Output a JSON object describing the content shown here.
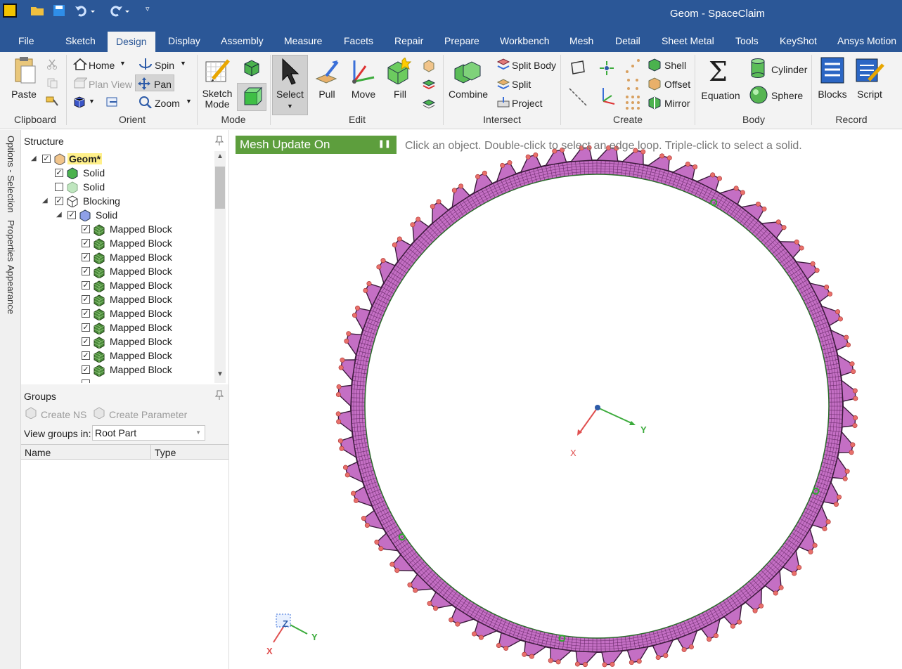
{
  "window": {
    "title": "Geom - SpaceClaim"
  },
  "tabs": [
    "File",
    "Sketch",
    "Design",
    "Display",
    "Assembly",
    "Measure",
    "Facets",
    "Repair",
    "Prepare",
    "Workbench",
    "Mesh",
    "Detail",
    "Sheet Metal",
    "Tools",
    "KeyShot",
    "Ansys Motion"
  ],
  "ribbon": {
    "clipboard": {
      "label": "Clipboard",
      "paste": "Paste"
    },
    "orient": {
      "label": "Orient",
      "home": "Home",
      "spin": "Spin",
      "plan_view": "Plan View",
      "pan": "Pan",
      "zoom": "Zoom"
    },
    "mode": {
      "label": "Mode",
      "sketch_mode": "Sketch Mode"
    },
    "edit": {
      "label": "Edit",
      "select": "Select",
      "pull": "Pull",
      "move": "Move",
      "fill": "Fill"
    },
    "intersect": {
      "label": "Intersect",
      "combine": "Combine",
      "split_body": "Split Body",
      "split": "Split",
      "project": "Project"
    },
    "create": {
      "label": "Create",
      "shell": "Shell",
      "offset": "Offset",
      "mirror": "Mirror"
    },
    "body": {
      "label": "Body",
      "equation": "Equation",
      "cylinder": "Cylinder",
      "sphere": "Sphere"
    },
    "record": {
      "label": "Record",
      "blocks": "Blocks",
      "script": "Script"
    }
  },
  "side_tabs": [
    "Options - Selection",
    "Properties",
    "Appearance"
  ],
  "structure": {
    "title": "Structure",
    "root": "Geom*",
    "solid1": "Solid",
    "solid2": "Solid",
    "blocking": "Blocking",
    "blocking_solid": "Solid",
    "mapped_block": "Mapped Block"
  },
  "groups": {
    "title": "Groups",
    "create_ns": "Create NS",
    "create_parameter": "Create Parameter",
    "view_groups_label": "View groups in:",
    "view_groups_value": "Root Part",
    "col_name": "Name",
    "col_type": "Type"
  },
  "viewport": {
    "mesh_update": "Mesh Update On",
    "hint": "Click an object. Double-click to select an edge loop. Triple-click to select a solid.",
    "axis_x": "X",
    "axis_y": "Y",
    "axis_z": "Z",
    "colors": {
      "mesh": "#c46fc4",
      "node": "#e8706b",
      "edge": "#3b1a3b",
      "green_node": "#2fa82f"
    }
  }
}
